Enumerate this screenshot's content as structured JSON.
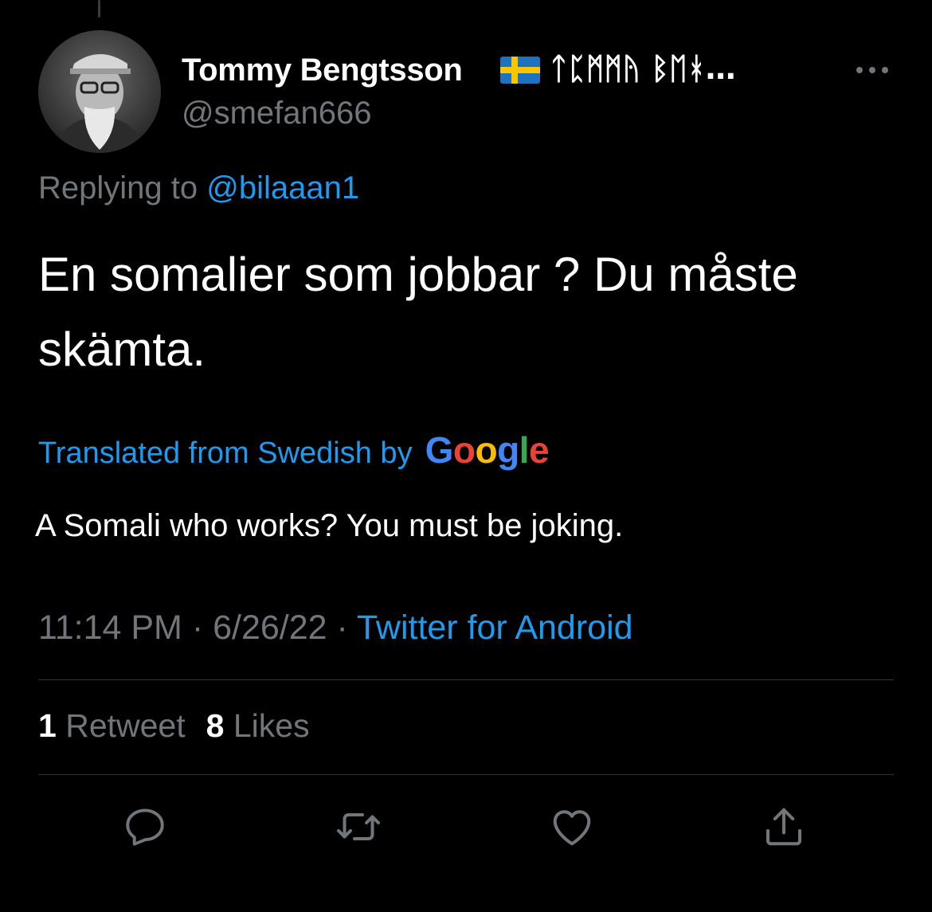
{
  "author": {
    "display_name": "Tommy Bengtsson",
    "runes": "ᛏᛈᛗᛗᚤ ᛒᛖᚼ…",
    "handle": "@smefan666",
    "flag": "swedish-flag"
  },
  "reply": {
    "prefix": "Replying to ",
    "mention": "@bilaaan1"
  },
  "tweet": {
    "text": "En somalier som jobbar ?  Du måste skämta."
  },
  "translation": {
    "label": "Translated from Swedish by",
    "provider": [
      "G",
      "o",
      "o",
      "g",
      "l",
      "e"
    ],
    "text": "A Somali who works? You must be joking."
  },
  "meta": {
    "time": "11:14 PM",
    "sep1": " · ",
    "date": "6/26/22",
    "sep2": " · ",
    "source": "Twitter for Android"
  },
  "stats": {
    "retweets_count": "1",
    "retweets_label": "Retweet",
    "likes_count": "8",
    "likes_label": "Likes"
  },
  "actions": [
    "reply-icon",
    "retweet-icon",
    "like-icon",
    "share-icon"
  ],
  "colors": {
    "accent": "#1d9bf0",
    "secondary_text": "#71767b",
    "background": "#000000"
  }
}
